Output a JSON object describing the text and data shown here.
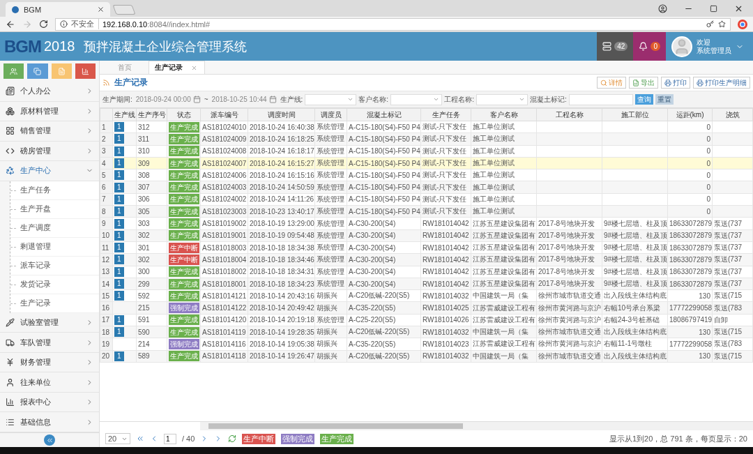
{
  "browser": {
    "tab_title": "BGM",
    "security": "不安全",
    "url_host": "192.168.0.10",
    "url_rest": ":8084//index.html#"
  },
  "header": {
    "logo": "BGM",
    "year": "2018",
    "title": "预拌混凝土企业综合管理系统",
    "messages_count": "42",
    "alerts_count": "0",
    "greeting": "欢迎",
    "user": "系统管理员"
  },
  "quick_buttons": [
    {
      "kind": "users",
      "color": "#6cae5c"
    },
    {
      "kind": "copy",
      "color": "#5b9bd5"
    },
    {
      "kind": "file",
      "color": "#f8c471"
    },
    {
      "kind": "chart",
      "color": "#d9574a"
    }
  ],
  "sidebar": {
    "items": [
      {
        "kind": "office",
        "label": "个人办公",
        "selected": false,
        "expanded": false
      },
      {
        "kind": "cubes",
        "label": "原材料管理",
        "selected": false,
        "expanded": false
      },
      {
        "kind": "grid",
        "label": "销售管理",
        "selected": false,
        "expanded": false
      },
      {
        "kind": "code",
        "label": "磅房管理",
        "selected": false,
        "expanded": false
      },
      {
        "kind": "recycle",
        "label": "生产中心",
        "selected": true,
        "expanded": true,
        "children": [
          {
            "label": "生产任务",
            "selected": false
          },
          {
            "label": "生产开盘",
            "selected": false
          },
          {
            "label": "生产调度",
            "selected": false
          },
          {
            "label": "剩退管理",
            "selected": false
          },
          {
            "label": "派车记录",
            "selected": false
          },
          {
            "label": "发货记录",
            "selected": false
          },
          {
            "label": "生产记录",
            "selected": false
          }
        ]
      },
      {
        "kind": "pipette",
        "label": "试验室管理",
        "selected": false,
        "expanded": false
      },
      {
        "kind": "truck",
        "label": "车队管理",
        "selected": false,
        "expanded": false
      },
      {
        "kind": "yen",
        "label": "财务管理",
        "selected": false,
        "expanded": false
      },
      {
        "kind": "user",
        "label": "往来单位",
        "selected": false,
        "expanded": false
      },
      {
        "kind": "chart",
        "label": "报表中心",
        "selected": false,
        "expanded": false
      },
      {
        "kind": "list",
        "label": "基础信息",
        "selected": false,
        "expanded": false
      }
    ]
  },
  "tabs": [
    {
      "label": "首页",
      "selected": false,
      "closable": false
    },
    {
      "label": "生产记录",
      "selected": true,
      "closable": true
    }
  ],
  "panel": {
    "title": "生产记录",
    "actions": [
      {
        "kind": "detail",
        "label": "详情"
      },
      {
        "kind": "export",
        "label": "导出"
      },
      {
        "kind": "print",
        "label": "打印"
      },
      {
        "kind": "print",
        "label": "打印生产明细"
      }
    ]
  },
  "filters": {
    "period_label": "生产期间:",
    "period_from": "2018-09-24 00:00",
    "period_separator": "~",
    "period_to": "2018-10-25 10:44",
    "selects": [
      {
        "label": "生产线:"
      },
      {
        "label": "客户名称:"
      },
      {
        "label": "工程名称:"
      }
    ],
    "mark_label": "混凝土标记:",
    "search_button": "查询",
    "reset_button": {
      "label": "重置",
      "disabled": true
    }
  },
  "table": {
    "columns": [
      "",
      "生产线",
      "生产序号",
      "状态",
      "派车编号",
      "调度时间",
      "调度员",
      "混凝土标记",
      "生产任务",
      "客户名称",
      "工程名称",
      "施工部位",
      "运距(km)",
      "浇筑"
    ],
    "rows": [
      {
        "index": "1",
        "line": "1",
        "seq": "312",
        "status": {
          "kind": "done",
          "label": "生产完成"
        },
        "dispatch_no": "AS181024010",
        "time": "2018-10-24 16:40:38",
        "dispatcher": "系统管理",
        "mark": "A-C15-180(S4)-F50 P4",
        "task": "测试-只下发任",
        "customer": "施工单位测试",
        "distance": "0",
        "selected": false
      },
      {
        "index": "2",
        "line": "1",
        "seq": "311",
        "status": {
          "kind": "done",
          "label": "生产完成"
        },
        "dispatch_no": "AS181024009",
        "time": "2018-10-24 16:18:25",
        "dispatcher": "系统管理",
        "mark": "A-C15-180(S4)-F50 P4",
        "task": "测试-只下发任",
        "customer": "施工单位测试",
        "distance": "0",
        "selected": false
      },
      {
        "index": "3",
        "line": "1",
        "seq": "310",
        "status": {
          "kind": "done",
          "label": "生产完成"
        },
        "dispatch_no": "AS181024008",
        "time": "2018-10-24 16:18:17",
        "dispatcher": "系统管理",
        "mark": "A-C15-180(S4)-F50 P4",
        "task": "测试-只下发任",
        "customer": "施工单位测试",
        "distance": "0",
        "selected": false
      },
      {
        "index": "4",
        "line": "1",
        "seq": "309",
        "status": {
          "kind": "done",
          "label": "生产完成"
        },
        "dispatch_no": "AS181024007",
        "time": "2018-10-24 16:15:27",
        "dispatcher": "系统管理",
        "mark": "A-C15-180(S4)-F50 P4",
        "task": "测试-只下发任",
        "customer": "施工单位测试",
        "distance": "0",
        "selected": true
      },
      {
        "index": "5",
        "line": "1",
        "seq": "308",
        "status": {
          "kind": "done",
          "label": "生产完成"
        },
        "dispatch_no": "AS181024006",
        "time": "2018-10-24 16:15:16",
        "dispatcher": "系统管理",
        "mark": "A-C15-180(S4)-F50 P4",
        "task": "测试-只下发任",
        "customer": "施工单位测试",
        "distance": "0",
        "selected": false
      },
      {
        "index": "6",
        "line": "1",
        "seq": "307",
        "status": {
          "kind": "done",
          "label": "生产完成"
        },
        "dispatch_no": "AS181024003",
        "time": "2018-10-24 14:50:59",
        "dispatcher": "系统管理",
        "mark": "A-C15-180(S4)-F50 P4",
        "task": "测试-只下发任",
        "customer": "施工单位测试",
        "distance": "0",
        "selected": false
      },
      {
        "index": "7",
        "line": "1",
        "seq": "306",
        "status": {
          "kind": "done",
          "label": "生产完成"
        },
        "dispatch_no": "AS181024002",
        "time": "2018-10-24 14:11:26",
        "dispatcher": "系统管理",
        "mark": "A-C15-180(S4)-F50 P4",
        "task": "测试-只下发任",
        "customer": "施工单位测试",
        "distance": "0",
        "selected": false
      },
      {
        "index": "8",
        "line": "1",
        "seq": "305",
        "status": {
          "kind": "done",
          "label": "生产完成"
        },
        "dispatch_no": "AS181023003",
        "time": "2018-10-23 13:40:17",
        "dispatcher": "系统管理",
        "mark": "A-C15-180(S4)-F50 P4",
        "task": "测试-只下发任",
        "customer": "施工单位测试",
        "distance": "0",
        "selected": false
      },
      {
        "index": "9",
        "line": "1",
        "seq": "303",
        "status": {
          "kind": "done",
          "label": "生产完成"
        },
        "dispatch_no": "AS181019002",
        "time": "2018-10-19 13:29:00",
        "dispatcher": "系统管理",
        "mark": "A-C30-200(S4)",
        "task": "RW181014042",
        "customer": "江苏五星建设集团有",
        "project": "2017-8号地块开发",
        "part": "9#楼七层墙、柱及顶",
        "distance": "18633072879",
        "pour": "泵送(737",
        "selected": false
      },
      {
        "index": "10",
        "line": "1",
        "seq": "302",
        "status": {
          "kind": "done",
          "label": "生产完成"
        },
        "dispatch_no": "AS181019001",
        "time": "2018-10-19 09:54:48",
        "dispatcher": "系统管理",
        "mark": "A-C30-200(S4)",
        "task": "RW181014042",
        "customer": "江苏五星建设集团有",
        "project": "2017-8号地块开发",
        "part": "9#楼七层墙、柱及顶",
        "distance": "18633072879",
        "pour": "泵送(737",
        "selected": false
      },
      {
        "index": "11",
        "line": "1",
        "seq": "301",
        "status": {
          "kind": "interrupted",
          "label": "生产中断"
        },
        "dispatch_no": "AS181018003",
        "time": "2018-10-18 18:34:38",
        "dispatcher": "系统管理",
        "mark": "A-C30-200(S4)",
        "task": "RW181014042",
        "customer": "江苏五星建设集团有",
        "project": "2017-8号地块开发",
        "part": "9#楼七层墙、柱及顶",
        "distance": "18633072879",
        "pour": "泵送(737",
        "selected": false
      },
      {
        "index": "12",
        "line": "1",
        "seq": "302",
        "status": {
          "kind": "interrupted",
          "label": "生产中断"
        },
        "dispatch_no": "AS181018004",
        "time": "2018-10-18 18:34:46",
        "dispatcher": "系统管理",
        "mark": "A-C30-200(S4)",
        "task": "RW181014042",
        "customer": "江苏五星建设集团有",
        "project": "2017-8号地块开发",
        "part": "9#楼七层墙、柱及顶",
        "distance": "18633072879",
        "pour": "泵送(737",
        "selected": false
      },
      {
        "index": "13",
        "line": "1",
        "seq": "300",
        "status": {
          "kind": "done",
          "label": "生产完成"
        },
        "dispatch_no": "AS181018002",
        "time": "2018-10-18 18:34:31",
        "dispatcher": "系统管理",
        "mark": "A-C30-200(S4)",
        "task": "RW181014042",
        "customer": "江苏五星建设集团有",
        "project": "2017-8号地块开发",
        "part": "9#楼七层墙、柱及顶",
        "distance": "18633072879",
        "pour": "泵送(737",
        "selected": false
      },
      {
        "index": "14",
        "line": "1",
        "seq": "299",
        "status": {
          "kind": "done",
          "label": "生产完成"
        },
        "dispatch_no": "AS181018001",
        "time": "2018-10-18 18:34:23",
        "dispatcher": "系统管理",
        "mark": "A-C30-200(S4)",
        "task": "RW181014042",
        "customer": "江苏五星建设集团有",
        "project": "2017-8号地块开发",
        "part": "9#楼七层墙、柱及顶",
        "distance": "18633072879",
        "pour": "泵送(737",
        "selected": false
      },
      {
        "index": "15",
        "line": "1",
        "seq": "592",
        "status": {
          "kind": "done",
          "label": "生产完成"
        },
        "dispatch_no": "AS181014121",
        "time": "2018-10-14 20:43:16",
        "dispatcher": "胡振兴",
        "mark": "A-C20低碱-220(S5)",
        "task": "RW181014032",
        "customer": "中国建筑一局（集",
        "project": "徐州市城市轨道交通",
        "part": "出入段线主体结构底",
        "distance": "130",
        "pour": "泵送(715",
        "selected": false
      },
      {
        "index": "16",
        "seq": "215",
        "status": {
          "kind": "forced",
          "label": "强制完成"
        },
        "dispatch_no": "AS181014122",
        "time": "2018-10-14 20:49:42",
        "dispatcher": "胡振兴",
        "mark": "A-C35-220(S5)",
        "task": "RW181014025",
        "customer": "江苏雷威建设工程有",
        "project": "徐州市黄河路与京沪",
        "part": "右幅10号承台系梁",
        "distance": "17772299058",
        "pour": "泵送(783",
        "selected": false
      },
      {
        "index": "17",
        "line": "1",
        "seq": "591",
        "status": {
          "kind": "done",
          "label": "生产完成"
        },
        "dispatch_no": "AS181014120",
        "time": "2018-10-14 20:19:18",
        "dispatcher": "系统管理",
        "mark": "A-C25-220(S5)",
        "task": "RW181014026",
        "customer": "江苏雷威建设工程有",
        "project": "徐州市黄河路与京沪",
        "part": "右幅24-3号桩基础",
        "distance": "18086797419",
        "pour": "自卸",
        "selected": false
      },
      {
        "index": "18",
        "line": "1",
        "seq": "590",
        "status": {
          "kind": "done",
          "label": "生产完成"
        },
        "dispatch_no": "AS181014119",
        "time": "2018-10-14 19:28:35",
        "dispatcher": "胡振兴",
        "mark": "A-C20低碱-220(S5)",
        "task": "RW181014032",
        "customer": "中国建筑一局（集",
        "project": "徐州市城市轨道交通",
        "part": "出入段线主体结构底",
        "distance": "130",
        "pour": "泵送(715",
        "selected": false
      },
      {
        "index": "19",
        "seq": "214",
        "status": {
          "kind": "forced",
          "label": "强制完成"
        },
        "dispatch_no": "AS181014116",
        "time": "2018-10-14 19:05:38",
        "dispatcher": "胡振兴",
        "mark": "A-C35-220(S5)",
        "task": "RW181014023",
        "customer": "江苏雷威建设工程有",
        "project": "徐州市黄河路与京沪",
        "part": "右幅11-1号墩柱",
        "distance": "17772299058",
        "pour": "泵送(783",
        "selected": false
      },
      {
        "index": "20",
        "line": "1",
        "seq": "589",
        "status": {
          "kind": "done",
          "label": "生产完成"
        },
        "dispatch_no": "AS181014118",
        "time": "2018-10-14 19:26:47",
        "dispatcher": "胡振兴",
        "mark": "A-C20低碱-220(S5)",
        "task": "RW181014032",
        "customer": "中国建筑一局（集",
        "project": "徐州市城市轨道交通",
        "part": "出入段线主体结构底",
        "distance": "130",
        "pour": "泵送(715",
        "selected": false
      }
    ]
  },
  "pager": {
    "page_size": "20",
    "page": "1",
    "total_pages": "/ 40",
    "legend": [
      {
        "kind": "interrupted",
        "label": "生产中断"
      },
      {
        "kind": "forced",
        "label": "强制完成"
      },
      {
        "kind": "done",
        "label": "生产完成"
      }
    ],
    "info": "显示从1到20，总 791 条，每页显示：20"
  }
}
